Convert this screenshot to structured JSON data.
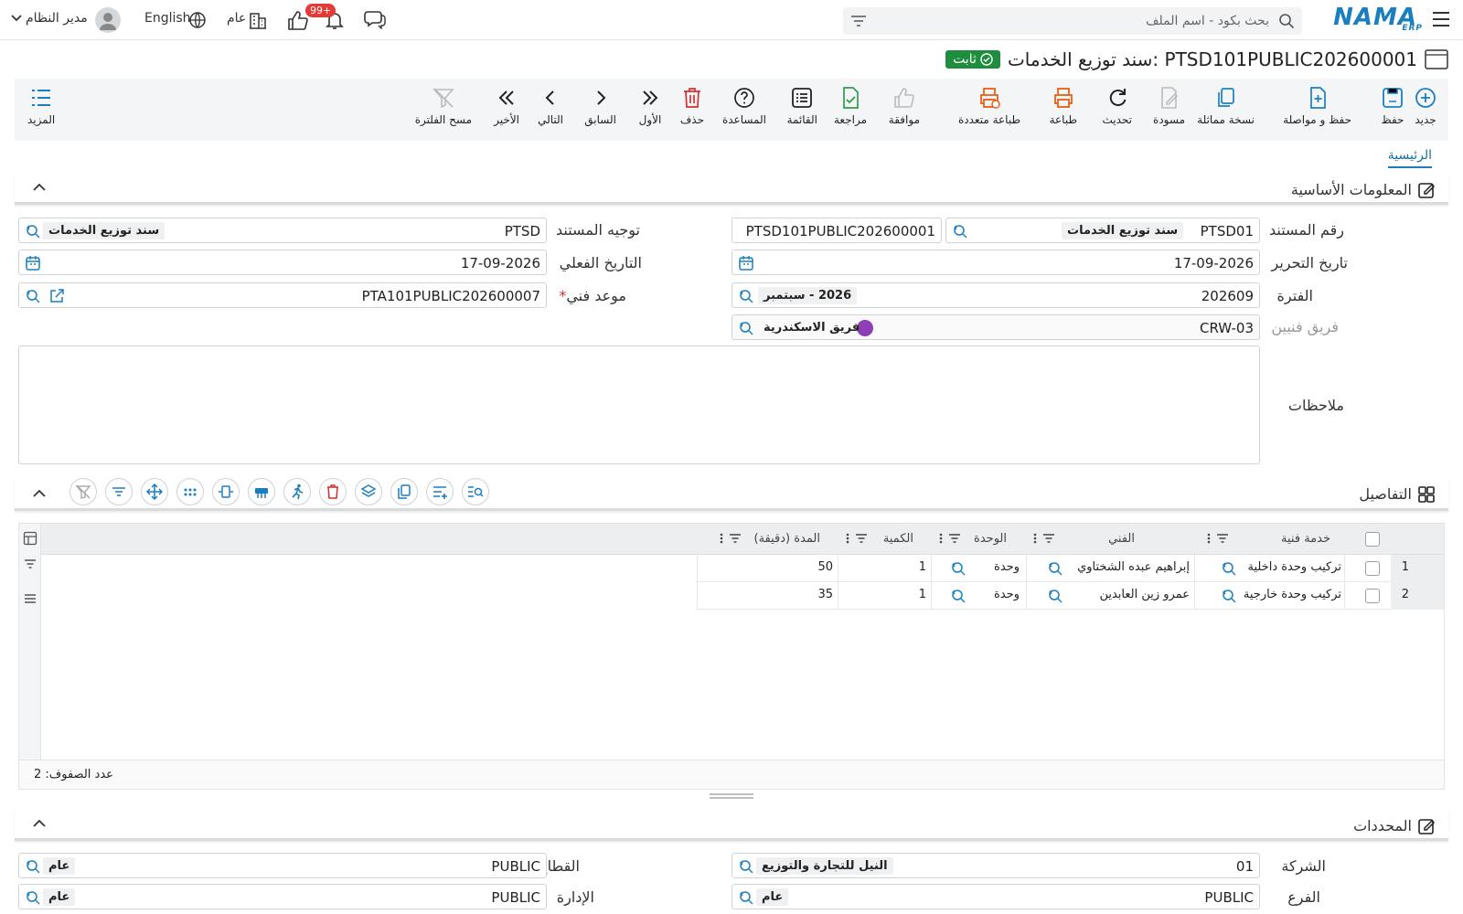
{
  "app": {
    "logo": "NAMA",
    "logo_sub": "ERP"
  },
  "topbar": {
    "search_placeholder": "بحث بكود - اسم الملف",
    "notifications_badge": "99+",
    "branch_label": "عام",
    "language_label": "English",
    "user_name": "مدير النظام"
  },
  "page": {
    "title": "سند توزيع الخدمات: PTSD101PUBLIC202600001",
    "status": "ثابت"
  },
  "toolbar": {
    "new": "جديد",
    "save": "حفظ",
    "save_continue": "حفظ و مواصلة",
    "duplicate": "نسخة مماثلة",
    "draft": "مسودة",
    "refresh": "تحديث",
    "print": "طباعة",
    "multi_print": "طباعة متعددة",
    "approve": "موافقة",
    "review": "مراجعة",
    "list": "القائمة",
    "help": "المساعدة",
    "delete": "حذف",
    "first": "الأول",
    "previous": "السابق",
    "next": "التالي",
    "last": "الأخير",
    "clear_filter": "مسح الفلترة",
    "more": "المزيد"
  },
  "tabs": {
    "main": "الرئيسية"
  },
  "basic": {
    "section_title": "المعلومات الأساسية",
    "doc_number_label": "رقم المستند",
    "doc_number_code": "PTSD01",
    "doc_number_name": "سند توزيع الخدمات",
    "doc_number_value": "PTSD101PUBLIC202600001",
    "direction_label": "توجيه المستند",
    "direction_code": "PTSD",
    "direction_name": "سند توزيع الخدمات",
    "edit_date_label": "تاريخ التحرير",
    "edit_date": "17-09-2026",
    "actual_date_label": "التاريخ الفعلي",
    "actual_date": "17-09-2026",
    "period_label": "الفترة",
    "period_code": "202609",
    "period_name": "2026 - سبتمبر",
    "appointment_label": "موعد فني",
    "appointment_value": "PTA101PUBLIC202600007",
    "required_mark": "*",
    "team_label": "فريق فنيين",
    "team_code": "CRW-03",
    "team_name": "فريق الاسكندرية",
    "team_color": "#8e3fb5",
    "notes_label": "ملاحظات"
  },
  "details": {
    "section_title": "التفاصيل",
    "columns": {
      "service": "خدمة فنية",
      "technician": "الفني",
      "unit": "الوحدة",
      "quantity": "الكمية",
      "duration": "المدة (دقيقة)"
    },
    "rows": [
      {
        "num": "1",
        "service": "تركيب وحدة داخلية",
        "technician": "إبراهيم عبده الشختاوي",
        "unit": "وحدة",
        "quantity": "1",
        "duration": "50"
      },
      {
        "num": "2",
        "service": "تركيب وحدة خارجية",
        "technician": "عمرو زين العابدين",
        "unit": "وحدة",
        "quantity": "1",
        "duration": "35"
      }
    ],
    "row_count": "عدد الصفوف: 2"
  },
  "dimensions": {
    "section_title": "المحددات",
    "company_label": "الشركة",
    "company_code": "01",
    "company_name": "النيل للتجارة والتوزيع",
    "sector_label": "القطاع",
    "sector_code": "PUBLIC",
    "sector_name": "عام",
    "branch_label": "الفرع",
    "branch_code": "PUBLIC",
    "branch_name": "عام",
    "department_label": "الإدارة",
    "department_code": "PUBLIC",
    "department_name": "عام"
  },
  "colors": {
    "accent": "#1a7fc0",
    "status_green": "#1e8e3e",
    "danger": "#d32f2f",
    "toolbar_bg": "#f4f5f6"
  }
}
